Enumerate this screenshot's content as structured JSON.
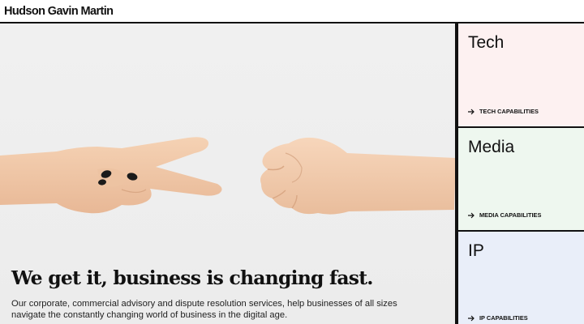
{
  "header": {
    "logo_text": "Hudson Gavin Martin"
  },
  "hero": {
    "headline": "We get it, business is changing fast.",
    "subtext": "Our corporate, commercial advisory and dispute resolution services, help businesses of all sizes navigate the constantly changing world of business in the digital age.",
    "image_alt_icon": "hands-rock-paper-scissors"
  },
  "panels": [
    {
      "title": "Tech",
      "link_label": "TECH CAPABILITIES",
      "link_icon": "arrow-right-icon",
      "bg": "#fdf1f1"
    },
    {
      "title": "Media",
      "link_label": "MEDIA CAPABILITIES",
      "link_icon": "arrow-right-icon",
      "bg": "#eef7ef"
    },
    {
      "title": "IP",
      "link_label": "IP CAPABILITIES",
      "link_icon": "arrow-right-icon",
      "bg": "#e9eef9"
    }
  ],
  "colors": {
    "border": "#111111",
    "hero_bg": "#eeeeee",
    "skin": "#f2c9a8",
    "nail": "#1a1a1a"
  }
}
